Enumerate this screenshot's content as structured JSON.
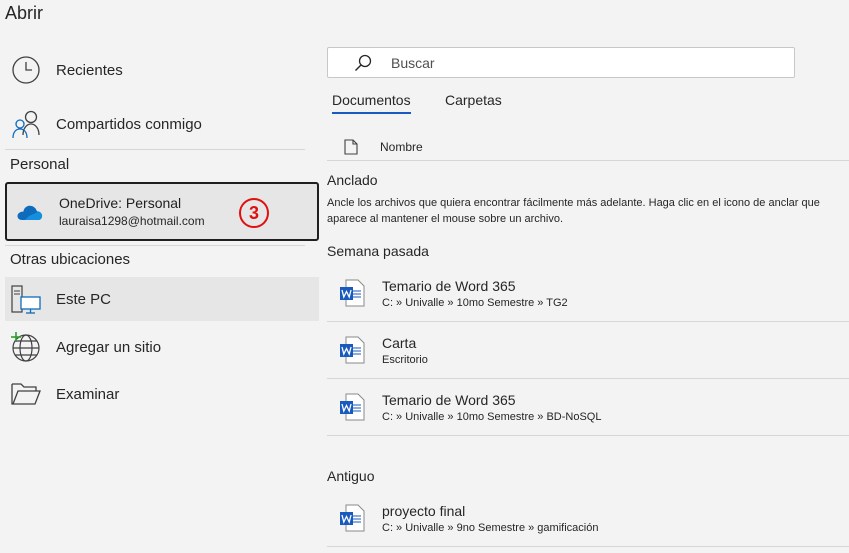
{
  "title": "Abrir",
  "nav": {
    "recent": "Recientes",
    "shared": "Compartidos conmigo",
    "personal_section": "Personal",
    "onedrive_title": "OneDrive: Personal",
    "onedrive_email": "lauraisa1298@hotmail.com",
    "badge": "3",
    "other_section": "Otras ubicaciones",
    "this_pc": "Este PC",
    "add_site": "Agregar un sitio",
    "browse": "Examinar"
  },
  "search": {
    "placeholder": "Buscar"
  },
  "tabs": [
    {
      "label": "Documentos",
      "active": true
    },
    {
      "label": "Carpetas",
      "active": false
    }
  ],
  "columns": {
    "name": "Nombre"
  },
  "pinned": {
    "title": "Anclado",
    "description": "Ancle los archivos que quiera encontrar fácilmente más adelante. Haga clic en el icono de anclar que aparece al mantener el mouse sobre un archivo."
  },
  "groups": [
    {
      "title": "Semana pasada",
      "files": [
        {
          "name": "Temario de Word 365",
          "path": "C: » Univalle » 10mo Semestre » TG2"
        },
        {
          "name": "Carta",
          "path": "Escritorio"
        },
        {
          "name": "Temario de Word 365",
          "path": "C: » Univalle » 10mo Semestre » BD-NoSQL"
        }
      ]
    },
    {
      "title": "Antiguo",
      "files": [
        {
          "name": "proyecto final",
          "path": "C: » Univalle » 9no Semestre » gamificación"
        }
      ]
    }
  ],
  "colors": {
    "accent": "#185abd",
    "badge": "#e01010",
    "word_blue": "#185abd",
    "onedrive_blue": "#0f6cbd"
  }
}
